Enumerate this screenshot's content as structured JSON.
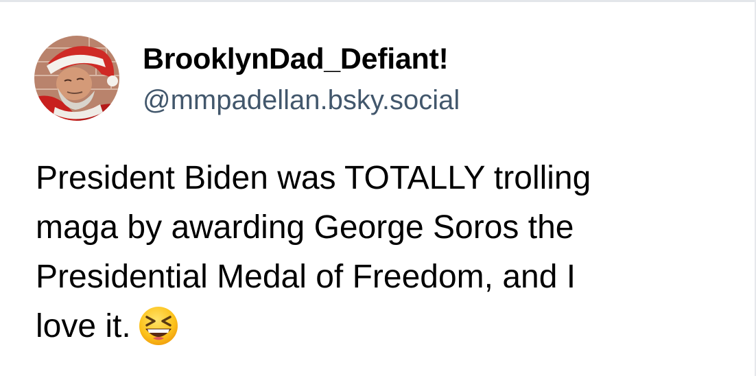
{
  "post": {
    "author": {
      "display_name": "BrooklynDad_Defiant!",
      "handle": "@mmpadellan.bsky.social",
      "avatar_icon": "user-avatar-santa"
    },
    "text_lines": [
      "President Biden was TOTALLY trolling",
      "maga by awarding George Soros the",
      "Presidential Medal of Freedom, and I",
      "love it."
    ],
    "emoji": "laughing-squinting-face-emoji"
  },
  "colors": {
    "handle": "#42576c",
    "text": "#000000",
    "background": "#ffffff"
  }
}
